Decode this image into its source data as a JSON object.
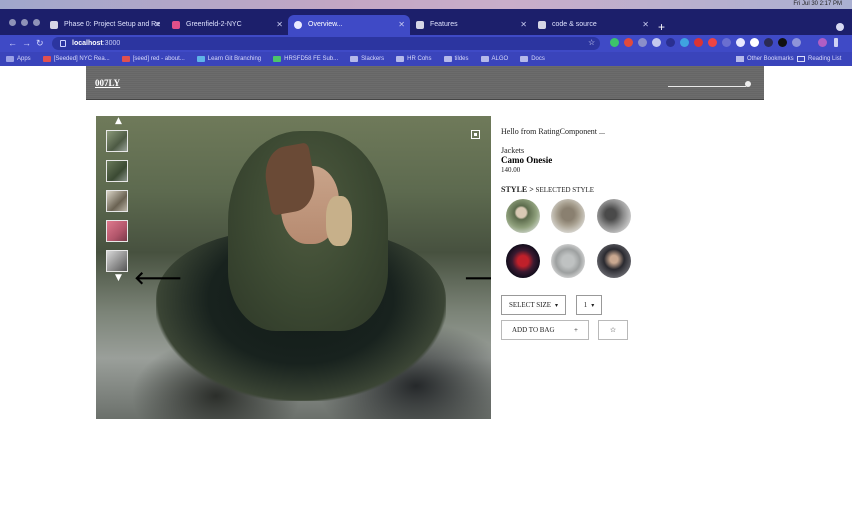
{
  "os": {
    "clock": "Fri Jul 30  2:17 PM"
  },
  "browser": {
    "tabs": [
      {
        "label": "Phase 0: Project Setup and Re",
        "active": false
      },
      {
        "label": "Greenfield-2-NYC",
        "active": false
      },
      {
        "label": "Overview...",
        "active": true
      },
      {
        "label": "Features",
        "active": false
      },
      {
        "label": "code & source",
        "active": false
      }
    ],
    "url_host": "localhost",
    "url_port": ":3000",
    "bookmarks": [
      {
        "label": "Apps"
      },
      {
        "label": "[Seeded] NYC Rea..."
      },
      {
        "label": "[seed] red - about..."
      },
      {
        "label": "Learn Git Branching"
      },
      {
        "label": "HRSFD58 FE Sub..."
      },
      {
        "label": "Slackers"
      },
      {
        "label": "HR Cohs"
      },
      {
        "label": "tildes"
      },
      {
        "label": "ALGO"
      },
      {
        "label": "Docs"
      }
    ],
    "bookmarks_right": [
      {
        "label": "Other Bookmarks"
      },
      {
        "label": "Reading List"
      }
    ]
  },
  "app": {
    "logo": "007LY",
    "rating_text": "Hello from RatingComponent ...",
    "product": {
      "category": "Jackets",
      "name": "Camo Onesie",
      "price": "140.00"
    },
    "style": {
      "label": "STYLE >",
      "selected": "SELECTED STYLE"
    },
    "size_select": "SELECT SIZE",
    "qty_select": "1",
    "add_to_bag": "ADD TO BAG",
    "add_to_bag_plus": "+",
    "favorite_glyph": "☆",
    "gallery": {
      "up_glyph": "▲",
      "down_glyph": "▼",
      "left_glyph": "🡐",
      "right_glyph": "🡒"
    }
  }
}
